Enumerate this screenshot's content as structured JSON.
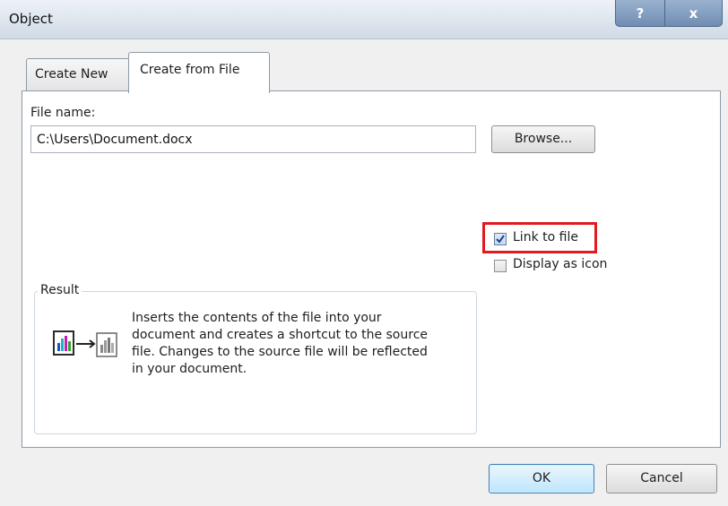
{
  "window": {
    "title": "Object",
    "help_glyph": "?",
    "close_glyph": "x"
  },
  "tabs": [
    {
      "label": "Create New",
      "mnemonic": "C",
      "active": false
    },
    {
      "label": "Create from File",
      "mnemonic": "F",
      "active": true
    }
  ],
  "file": {
    "label": "File name:",
    "mnemonic": "n",
    "value": "C:\\Users\\Document.docx",
    "browse_label": "Browse..."
  },
  "options": {
    "link_to_file": {
      "label": "Link to file",
      "checked": true
    },
    "display_as_icon": {
      "label": "Display as icon",
      "checked": false
    }
  },
  "result": {
    "legend": "Result",
    "lines": [
      "Inserts the contents of the file into your",
      "document and creates a shortcut to the source",
      "file.  Changes to the source file will be reflected",
      "in your document."
    ]
  },
  "buttons": {
    "ok": "OK",
    "cancel": "Cancel"
  },
  "colors": {
    "highlight": "#e2191f",
    "ok_border": "#3c7fb1"
  }
}
